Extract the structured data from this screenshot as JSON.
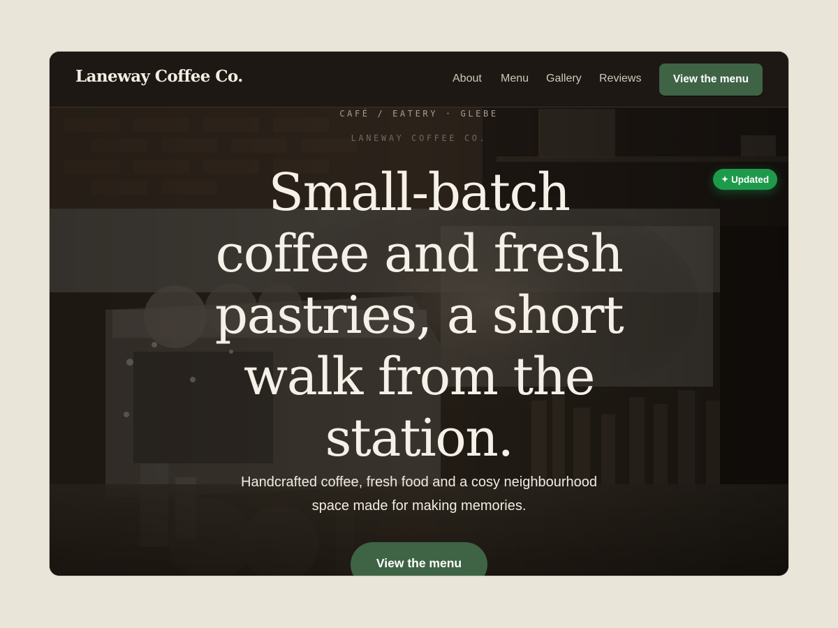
{
  "nav": {
    "brand": "Laneway Coffee Co.",
    "links": [
      "About",
      "Menu",
      "Gallery",
      "Reviews"
    ],
    "cta_label": "View the menu"
  },
  "hero": {
    "eyebrow_primary": "CAFÉ / EATERY · GLEBE",
    "eyebrow_secondary": "LANEWAY COFFEE CO.",
    "headline_lines": [
      "Small-batch",
      "coffee and fresh",
      "pastries, a short",
      "walk from the",
      "station."
    ],
    "subtext_lines": [
      "Handcrafted coffee, fresh food and a cosy neighbourhood",
      "space made for making memories."
    ],
    "cta_label": "View the menu",
    "badge_label": "Updated",
    "badge_icon": "sparkle-icon"
  },
  "colors": {
    "page_background": "#eae5d9",
    "nav_background": "#1d1813",
    "accent_green": "#3f6345",
    "badge_green": "#1e9a4b",
    "headline_text": "#f6f1e8"
  }
}
